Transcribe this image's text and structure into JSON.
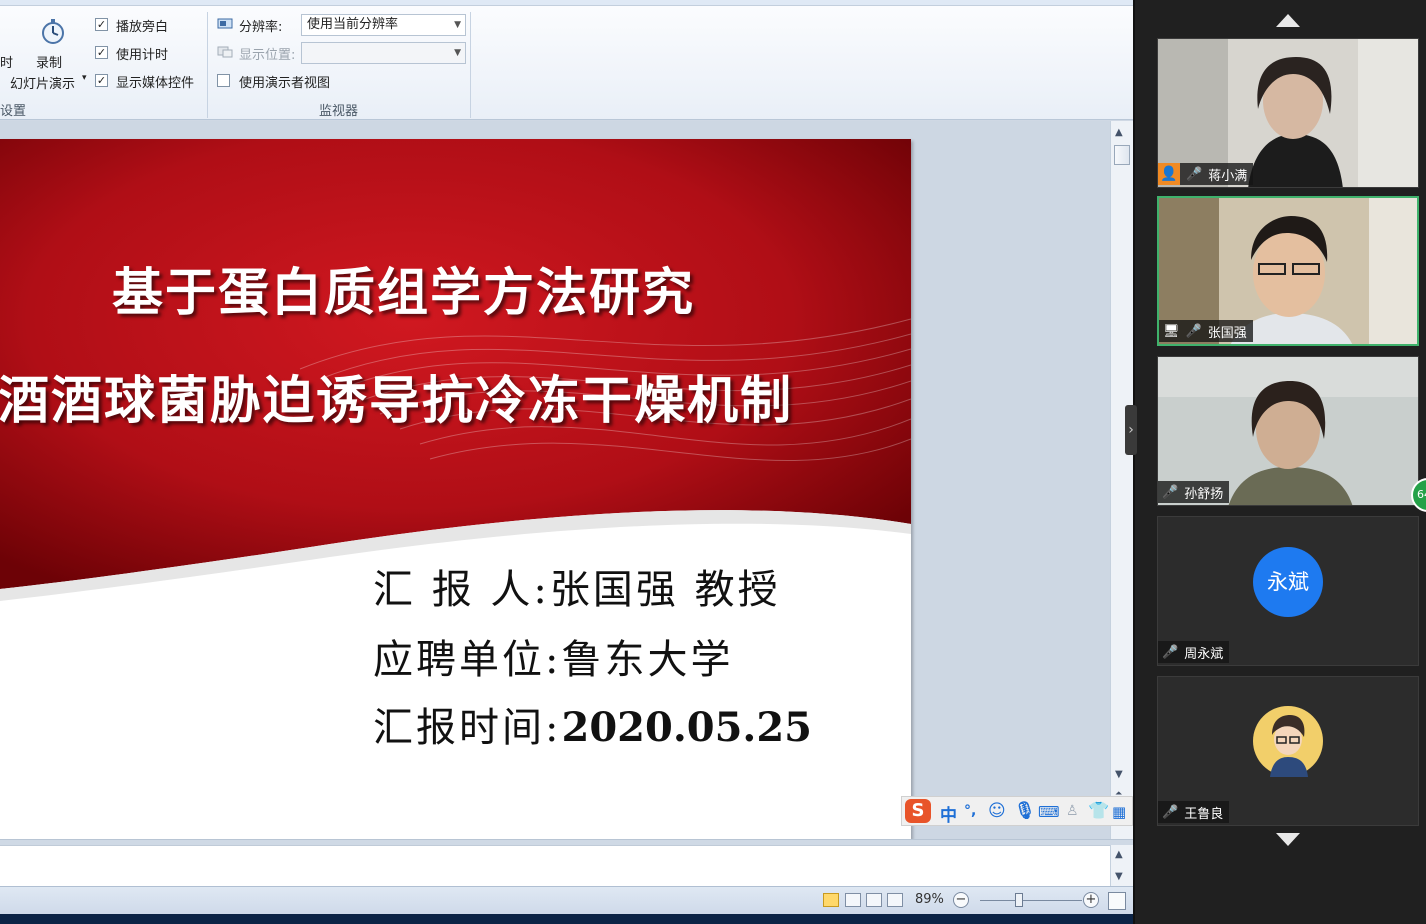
{
  "ribbon": {
    "record_label": "录制",
    "slideshow_label": "幻灯片演示",
    "partial_left_char": "时",
    "group_left_label": "设置",
    "play_narration": "播放旁白",
    "use_timings": "使用计时",
    "show_media_controls": "显示媒体控件",
    "resolution_label": "分辨率:",
    "resolution_value": "使用当前分辨率",
    "show_on_label": "显示位置:",
    "presenter_view": "使用演示者视图",
    "monitors_group": "监视器"
  },
  "slide": {
    "title_line1": "基于蛋白质组学方法研究",
    "title_line2": "酒酒球菌胁迫诱导抗冷冻干燥机制",
    "reporter_label": "汇 报 人:",
    "reporter_value": "张国强 教授",
    "unit_label": "应聘单位:",
    "unit_value": "鲁东大学",
    "time_label": "汇报时间:",
    "time_value": "2020.05.25",
    "colors": {
      "red": "#c0121a",
      "dark_red": "#7a0208"
    }
  },
  "ime": {
    "logo": "S",
    "mode": "中",
    "punct": "°,"
  },
  "status": {
    "zoom": "89%"
  },
  "participants": [
    {
      "name": "蒋小满",
      "mic": "muted"
    },
    {
      "name": "张国强",
      "mic": "active",
      "speaking": true
    },
    {
      "name": "孙舒扬",
      "mic": "on"
    },
    {
      "name": "周永斌",
      "mic": "muted",
      "avatar_text": "永斌"
    },
    {
      "name": "王鲁良",
      "mic": "muted"
    }
  ],
  "side_badge": "64"
}
